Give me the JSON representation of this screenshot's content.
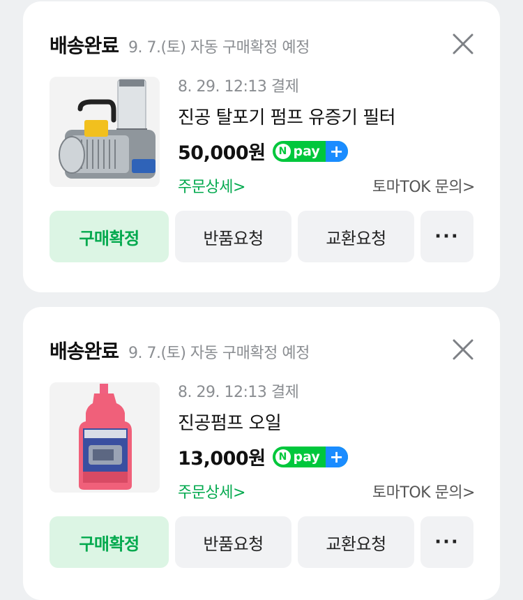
{
  "orders": [
    {
      "status": "배송완료",
      "auto_confirm_note": "9. 7.(토) 자동 구매확정 예정",
      "close_icon": "close-icon",
      "thumbnail_icon": "vacuum-pump-image",
      "payment_date": "8. 29. 12:13 결제",
      "product_name": "진공 탈포기 펌프 유증기 필터",
      "price": "50,000원",
      "npay_label": "pay",
      "npay_n": "N",
      "npay_plus": "+",
      "detail_link": "주문상세>",
      "inquiry_link": "토마TOK 문의>",
      "buttons": {
        "confirm": "구매확정",
        "return": "반품요청",
        "exchange": "교환요청",
        "more": "···"
      }
    },
    {
      "status": "배송완료",
      "auto_confirm_note": "9. 7.(토) 자동 구매확정 예정",
      "close_icon": "close-icon",
      "thumbnail_icon": "pump-oil-bottle-image",
      "payment_date": "8. 29. 12:13 결제",
      "product_name": "진공펌프 오일",
      "price": "13,000원",
      "npay_label": "pay",
      "npay_n": "N",
      "npay_plus": "+",
      "detail_link": "주문상세>",
      "inquiry_link": "토마TOK 문의>",
      "buttons": {
        "confirm": "구매확정",
        "return": "반품요청",
        "exchange": "교환요청",
        "more": "···"
      }
    }
  ],
  "colors": {
    "accent_green": "#03a94e",
    "confirm_bg": "#dcf5e4",
    "npay_green": "#00c73c",
    "npay_blue": "#1a8cff",
    "page_bg": "#eef0f2"
  }
}
